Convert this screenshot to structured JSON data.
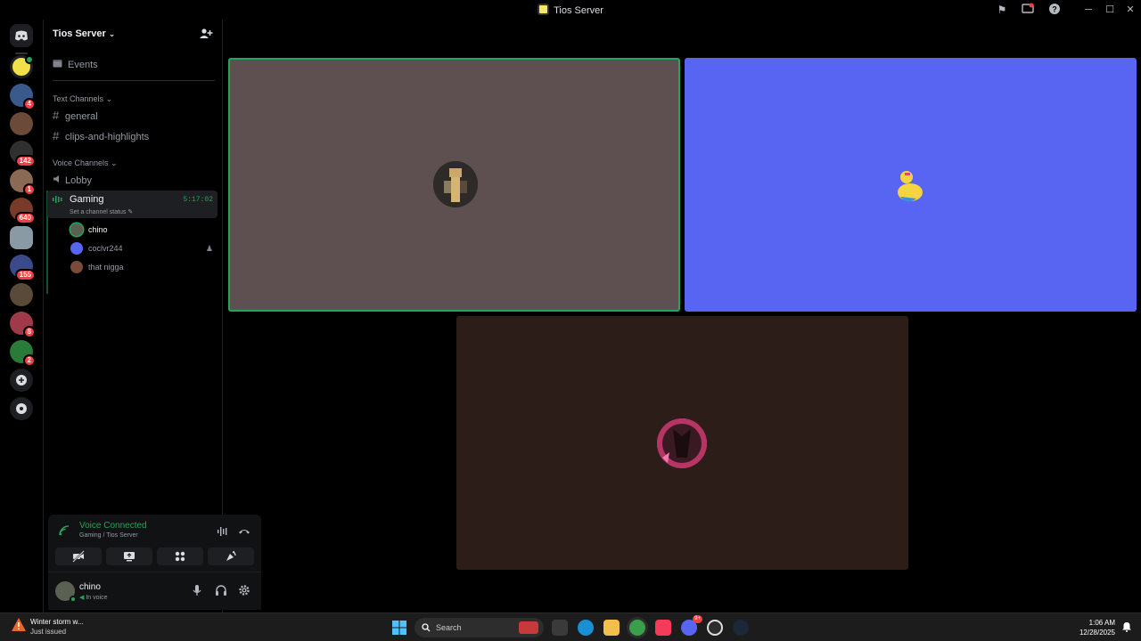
{
  "window": {
    "title": "Tios Server"
  },
  "server": {
    "name": "Tios Server",
    "events_label": "Events",
    "text_category": "Text Channels",
    "voice_category": "Voice Channels",
    "text_channels": [
      "general",
      "clips-and-highlights"
    ],
    "voice_channels": {
      "lobby": "Lobby",
      "active": {
        "name": "Gaming",
        "timer": "5:17:02",
        "status": "Set a channel status"
      },
      "members": [
        "chino",
        "coclvr244",
        "that nigga"
      ]
    }
  },
  "rail_badges": [
    "4",
    "142",
    "1",
    "640",
    "155",
    "8",
    "2"
  ],
  "voice_panel": {
    "status": "Voice Connected",
    "sub": "Gaming / Tios Server"
  },
  "user_panel": {
    "name": "chino",
    "sub": "In voice"
  },
  "taskbar": {
    "weather_title": "Winter storm w...",
    "weather_sub": "Just issued",
    "search": "Search",
    "time": "1:06 AM",
    "date": "12/28/2025",
    "discord_badge": "9+"
  },
  "colors": {
    "tile1": "#5e5050",
    "tile2": "#5865f2",
    "tile3": "#2c1d18",
    "speaking": "#23a55a",
    "badge": "#f23f43"
  }
}
